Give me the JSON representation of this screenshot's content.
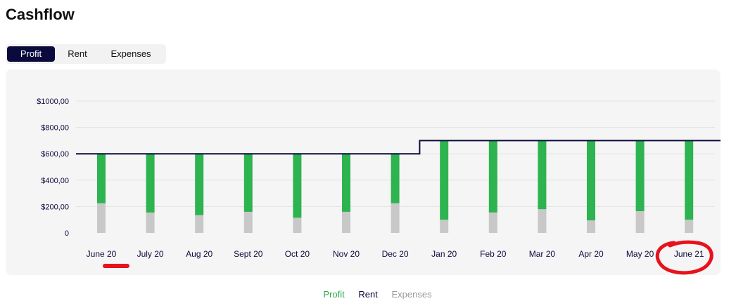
{
  "page": {
    "title": "Cashflow"
  },
  "tabs": [
    {
      "label": "Profit",
      "active": true
    },
    {
      "label": "Rent",
      "active": false
    },
    {
      "label": "Expenses",
      "active": false
    }
  ],
  "legend": {
    "profit": "Profit",
    "rent": "Rent",
    "expenses": "Expenses"
  },
  "colors": {
    "profit": "#2db34f",
    "expenses": "#c8c8c8",
    "rent_line": "#0b0a3d",
    "active_tab": "#0b0a3d",
    "annotation": "#e8121c"
  },
  "chart_data": {
    "type": "bar",
    "stacked": true,
    "categories": [
      "June 20",
      "July 20",
      "Aug 20",
      "Sept 20",
      "Oct 20",
      "Nov 20",
      "Dec 20",
      "Jan 20",
      "Feb 20",
      "Mar 20",
      "Apr 20",
      "May 20",
      "June 21"
    ],
    "series": [
      {
        "name": "Expenses",
        "values": [
          225,
          155,
          135,
          160,
          115,
          160,
          225,
          100,
          155,
          180,
          95,
          165,
          100
        ]
      },
      {
        "name": "Profit",
        "values": [
          375,
          445,
          465,
          440,
          485,
          440,
          375,
          600,
          545,
          520,
          605,
          535,
          600
        ]
      }
    ],
    "rent_line": {
      "name": "Rent",
      "values": [
        600,
        600,
        600,
        600,
        600,
        600,
        600,
        700,
        700,
        700,
        700,
        700,
        700
      ]
    },
    "yticks": [
      "0",
      "$200,00",
      "$400,00",
      "$600,00",
      "$800,00",
      "$1000,00"
    ],
    "ylim": [
      0,
      1000
    ],
    "grid": true,
    "legend_position": "bottom-center",
    "annotations": [
      "underline under June 20",
      "circle around June 21"
    ]
  }
}
